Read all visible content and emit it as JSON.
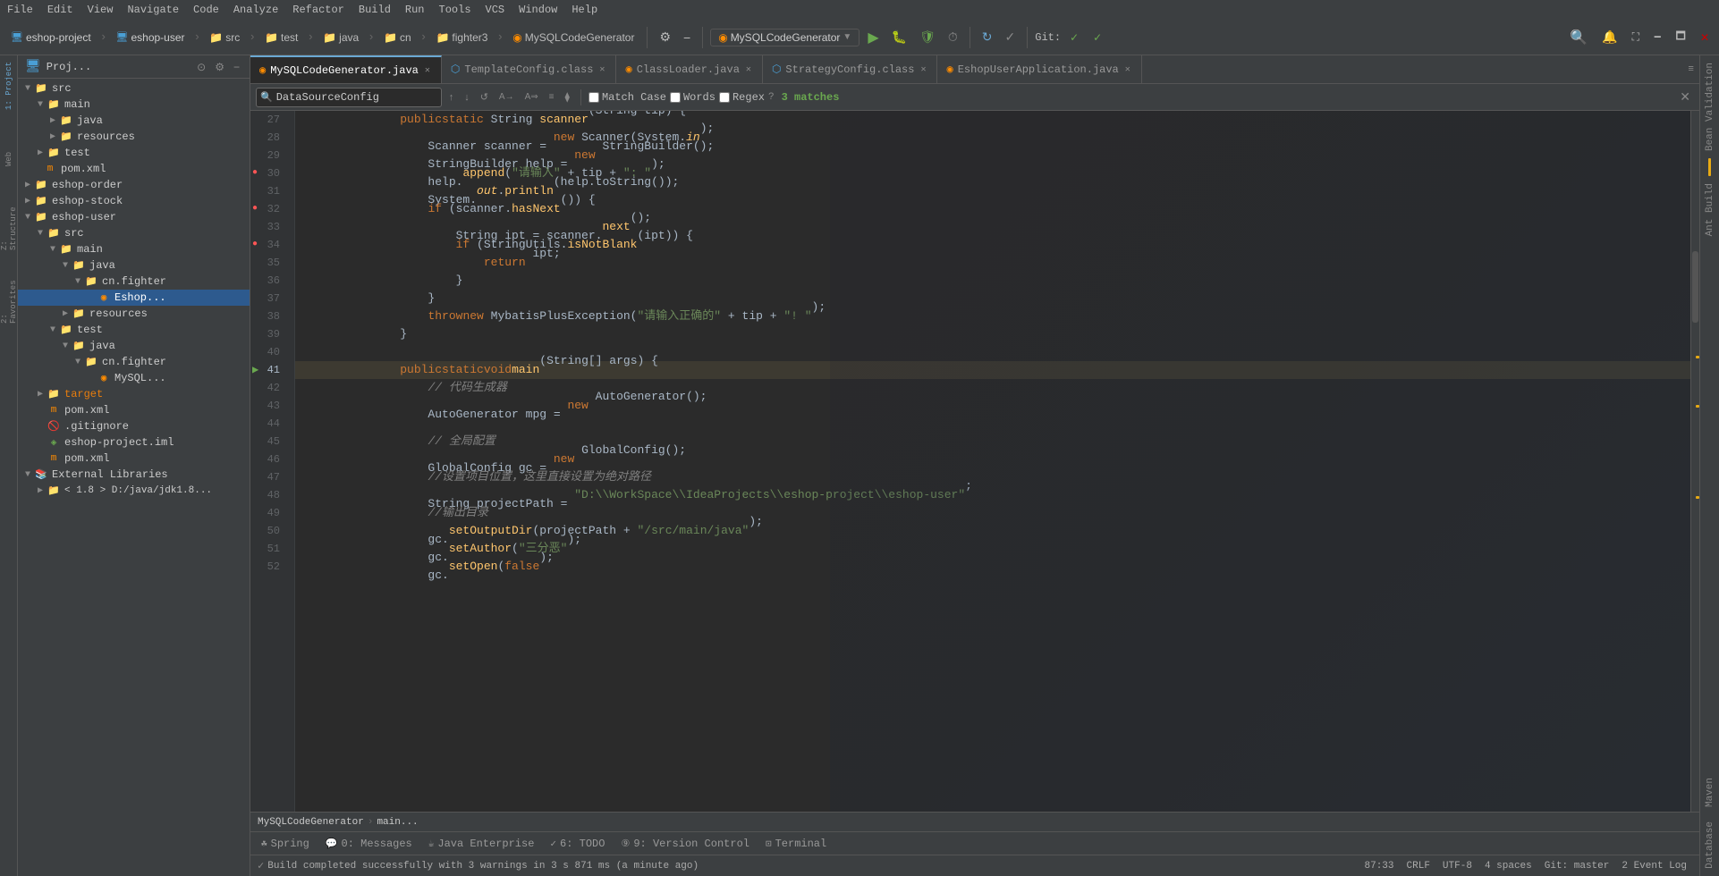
{
  "menuBar": {
    "items": [
      "File",
      "Edit",
      "View",
      "Navigate",
      "Code",
      "Analyze",
      "Refactor",
      "Build",
      "Run",
      "Tools",
      "VCS",
      "Window",
      "Help"
    ]
  },
  "toolbar": {
    "projects": [
      "eshop-project",
      "eshop-user"
    ],
    "breadcrumb": [
      "src",
      "test",
      "java",
      "cn",
      "fighter3"
    ],
    "currentFile": "MySQLCodeGenerator",
    "runDropdown": "MySQLCodeGenerator",
    "gitLabel": "Git:",
    "gitBranch": "master"
  },
  "panel": {
    "title": "Proj...",
    "tree": [
      {
        "id": 1,
        "indent": 0,
        "expanded": true,
        "type": "folder",
        "name": "src"
      },
      {
        "id": 2,
        "indent": 1,
        "expanded": true,
        "type": "folder",
        "name": "main"
      },
      {
        "id": 3,
        "indent": 2,
        "expanded": false,
        "type": "folder-blue",
        "name": "java"
      },
      {
        "id": 4,
        "indent": 2,
        "expanded": false,
        "type": "folder-resources",
        "name": "resources"
      },
      {
        "id": 5,
        "indent": 1,
        "expanded": false,
        "type": "folder",
        "name": "test"
      },
      {
        "id": 6,
        "indent": 0,
        "expanded": false,
        "type": "xml",
        "name": "pom.xml"
      },
      {
        "id": 7,
        "indent": 0,
        "expanded": true,
        "type": "folder",
        "name": "eshop-order"
      },
      {
        "id": 8,
        "indent": 0,
        "expanded": false,
        "type": "folder",
        "name": "eshop-stock"
      },
      {
        "id": 9,
        "indent": 0,
        "expanded": true,
        "type": "folder",
        "name": "eshop-user"
      },
      {
        "id": 10,
        "indent": 1,
        "expanded": true,
        "type": "folder",
        "name": "src"
      },
      {
        "id": 11,
        "indent": 2,
        "expanded": true,
        "type": "folder",
        "name": "main"
      },
      {
        "id": 12,
        "indent": 3,
        "expanded": true,
        "type": "folder-blue",
        "name": "java"
      },
      {
        "id": 13,
        "indent": 4,
        "expanded": true,
        "type": "folder",
        "name": "cn.fighter"
      },
      {
        "id": 14,
        "indent": 5,
        "expanded": false,
        "type": "java-class",
        "name": "Eshop..."
      },
      {
        "id": 15,
        "indent": 3,
        "expanded": false,
        "type": "folder-resources",
        "name": "resources"
      },
      {
        "id": 16,
        "indent": 2,
        "expanded": true,
        "type": "folder",
        "name": "test"
      },
      {
        "id": 17,
        "indent": 3,
        "expanded": true,
        "type": "folder-blue",
        "name": "java"
      },
      {
        "id": 18,
        "indent": 4,
        "expanded": true,
        "type": "folder",
        "name": "cn.fighter"
      },
      {
        "id": 19,
        "indent": 5,
        "expanded": false,
        "type": "mysql-class",
        "name": "MySQL..."
      },
      {
        "id": 20,
        "indent": 1,
        "expanded": false,
        "type": "folder-orange",
        "name": "target"
      },
      {
        "id": 21,
        "indent": 1,
        "expanded": false,
        "type": "xml",
        "name": "pom.xml"
      },
      {
        "id": 22,
        "indent": 1,
        "expanded": false,
        "type": "gitignore",
        "name": ".gitignore"
      },
      {
        "id": 23,
        "indent": 1,
        "expanded": false,
        "type": "iml",
        "name": "eshop-project.iml"
      },
      {
        "id": 24,
        "indent": 1,
        "expanded": false,
        "type": "xml",
        "name": "pom.xml"
      },
      {
        "id": 25,
        "indent": 0,
        "expanded": true,
        "type": "folder-lib",
        "name": "External Libraries"
      },
      {
        "id": 26,
        "indent": 1,
        "expanded": false,
        "type": "folder",
        "name": "< 1.8 > D:/java/jdk1.8..."
      }
    ]
  },
  "tabs": [
    {
      "id": 1,
      "label": "MySQLCodeGenerator.java",
      "active": true,
      "icon": "orange-circle",
      "closeable": true
    },
    {
      "id": 2,
      "label": "TemplateConfig.class",
      "active": false,
      "icon": "class",
      "closeable": true
    },
    {
      "id": 3,
      "label": "ClassLoader.java",
      "active": false,
      "icon": "java",
      "closeable": true
    },
    {
      "id": 4,
      "label": "StrategyConfig.class",
      "active": false,
      "icon": "class",
      "closeable": true
    },
    {
      "id": 5,
      "label": "EshopUserApplication.java",
      "active": false,
      "icon": "java",
      "closeable": true
    }
  ],
  "searchBar": {
    "placeholder": "DataSourceConfig",
    "value": "DataSourceConfig",
    "matchCase": false,
    "words": false,
    "regex": false,
    "matchCaseLabel": "Match Case",
    "wordsLabel": "Words",
    "regexLabel": "Regex",
    "matches": "3 matches"
  },
  "code": {
    "lines": [
      {
        "num": 27,
        "content": [
          {
            "t": "kw",
            "v": "public"
          },
          {
            "t": "type",
            "v": " "
          },
          {
            "t": "kw",
            "v": "static"
          },
          {
            "t": "type",
            "v": " String "
          },
          {
            "t": "method",
            "v": "scanner"
          },
          {
            "t": "type",
            "v": "(String tip) {"
          }
        ],
        "bp": false,
        "run": false
      },
      {
        "num": 28,
        "content": [
          {
            "t": "type",
            "v": "    Scanner scanner = "
          },
          {
            "t": "kw",
            "v": "new"
          },
          {
            "t": "type",
            "v": " Scanner(System."
          },
          {
            "t": "static-method",
            "v": "in"
          },
          {
            "t": "type",
            "v": ");"
          }
        ],
        "bp": false,
        "run": false
      },
      {
        "num": 29,
        "content": [
          {
            "t": "type",
            "v": "    StringBuilder help = "
          },
          {
            "t": "kw",
            "v": "new"
          },
          {
            "t": "type",
            "v": " StringBuilder();"
          }
        ],
        "bp": false,
        "run": false
      },
      {
        "num": 30,
        "content": [
          {
            "t": "type",
            "v": "    help."
          },
          {
            "t": "method",
            "v": "append"
          },
          {
            "t": "str",
            "v": "(\"请输入\""
          },
          {
            "t": "type",
            "v": " + tip + "
          },
          {
            "t": "str",
            "v": "\": \""
          }
        ],
        "bp": true,
        "run": false
      },
      {
        "num": 31,
        "content": [
          {
            "t": "type",
            "v": "    System."
          },
          {
            "t": "static-method",
            "v": "out"
          },
          {
            "t": "type",
            "v": "."
          },
          {
            "t": "method",
            "v": "println"
          },
          {
            "t": "type",
            "v": "(help.toString());"
          }
        ],
        "bp": false,
        "run": false
      },
      {
        "num": 32,
        "content": [
          {
            "t": "type",
            "v": "    "
          },
          {
            "t": "kw",
            "v": "if"
          },
          {
            "t": "type",
            "v": " (scanner."
          },
          {
            "t": "method",
            "v": "hasNext"
          },
          {
            "t": "type",
            "v": "()) {"
          }
        ],
        "bp": true,
        "run": false
      },
      {
        "num": 33,
        "content": [
          {
            "t": "type",
            "v": "        String ipt = scanner."
          },
          {
            "t": "method",
            "v": "next"
          },
          {
            "t": "type",
            "v": "();"
          }
        ],
        "bp": false,
        "run": false
      },
      {
        "num": 34,
        "content": [
          {
            "t": "type",
            "v": "        "
          },
          {
            "t": "kw",
            "v": "if"
          },
          {
            "t": "type",
            "v": " (StringUtils."
          },
          {
            "t": "method",
            "v": "isNotBlank"
          },
          {
            "t": "type",
            "v": "(ipt)) {"
          }
        ],
        "bp": true,
        "run": false
      },
      {
        "num": 35,
        "content": [
          {
            "t": "type",
            "v": "            "
          },
          {
            "t": "kw",
            "v": "return"
          },
          {
            "t": "type",
            "v": " ipt;"
          }
        ],
        "bp": false,
        "run": false
      },
      {
        "num": 36,
        "content": [
          {
            "t": "type",
            "v": "        }"
          }
        ],
        "bp": false,
        "run": false
      },
      {
        "num": 37,
        "content": [
          {
            "t": "type",
            "v": "    }"
          }
        ],
        "bp": false,
        "run": false
      },
      {
        "num": 38,
        "content": [
          {
            "t": "type",
            "v": "    "
          },
          {
            "t": "kw",
            "v": "throw"
          },
          {
            "t": "type",
            "v": " "
          },
          {
            "t": "kw",
            "v": "new"
          },
          {
            "t": "type",
            "v": " MybatisPlusException("
          },
          {
            "t": "str",
            "v": "\"请输入正确的\""
          },
          {
            "t": "type",
            "v": " + tip + "
          },
          {
            "t": "str",
            "v": "\"! \""
          }
        ],
        "bp": false,
        "run": false
      },
      {
        "num": 39,
        "content": [
          {
            "t": "type",
            "v": "}"
          }
        ],
        "bp": false,
        "run": false
      },
      {
        "num": 40,
        "content": [
          {
            "t": "type",
            "v": ""
          }
        ],
        "bp": false,
        "run": false
      },
      {
        "num": 41,
        "content": [
          {
            "t": "kw",
            "v": "public"
          },
          {
            "t": "type",
            "v": " "
          },
          {
            "t": "kw",
            "v": "static"
          },
          {
            "t": "type",
            "v": " "
          },
          {
            "t": "kw",
            "v": "void"
          },
          {
            "t": "type",
            "v": " "
          },
          {
            "t": "method",
            "v": "main"
          },
          {
            "t": "type",
            "v": "(String[] args) {"
          }
        ],
        "bp": false,
        "run": true
      },
      {
        "num": 42,
        "content": [
          {
            "t": "comment",
            "v": "    // 代码生成器"
          }
        ],
        "bp": false,
        "run": false
      },
      {
        "num": 43,
        "content": [
          {
            "t": "type",
            "v": "    AutoGenerator mpg = "
          },
          {
            "t": "kw",
            "v": "new"
          },
          {
            "t": "type",
            "v": " AutoGenerator();"
          }
        ],
        "bp": false,
        "run": false
      },
      {
        "num": 44,
        "content": [
          {
            "t": "type",
            "v": ""
          }
        ],
        "bp": false,
        "run": false
      },
      {
        "num": 45,
        "content": [
          {
            "t": "comment",
            "v": "    // 全局配置"
          }
        ],
        "bp": false,
        "run": false
      },
      {
        "num": 46,
        "content": [
          {
            "t": "type",
            "v": "    GlobalConfig gc = "
          },
          {
            "t": "kw",
            "v": "new"
          },
          {
            "t": "type",
            "v": " GlobalConfig();"
          }
        ],
        "bp": false,
        "run": false
      },
      {
        "num": 47,
        "content": [
          {
            "t": "cn-comment",
            "v": "    //设置项目位置，这里直接设置为绝对路径"
          }
        ],
        "bp": false,
        "run": false
      },
      {
        "num": 48,
        "content": [
          {
            "t": "type",
            "v": "    String projectPath = "
          },
          {
            "t": "str",
            "v": "\"D:\\\\WorkSpace\\\\IdeaProjects\\\\eshop-project\\\\eshop-user\""
          }
        ],
        "bp": false,
        "run": false
      },
      {
        "num": 49,
        "content": [
          {
            "t": "cn-comment",
            "v": "    //输出目录"
          }
        ],
        "bp": false,
        "run": false
      },
      {
        "num": 50,
        "content": [
          {
            "t": "type",
            "v": "    gc."
          },
          {
            "t": "method",
            "v": "setOutputDir"
          },
          {
            "t": "type",
            "v": "(projectPath + "
          },
          {
            "t": "str",
            "v": "\"/src/main/java\""
          },
          {
            "t": "type",
            "v": ");"
          }
        ],
        "bp": false,
        "run": false
      },
      {
        "num": 51,
        "content": [
          {
            "t": "type",
            "v": "    gc."
          },
          {
            "t": "method",
            "v": "setAuthor"
          },
          {
            "t": "type",
            "v": "("
          },
          {
            "t": "str",
            "v": "\"三分恶\""
          },
          {
            "t": "type",
            "v": ");"
          }
        ],
        "bp": false,
        "run": false
      },
      {
        "num": 52,
        "content": [
          {
            "t": "type",
            "v": "    gc."
          },
          {
            "t": "method",
            "v": "setOpen"
          },
          {
            "t": "type",
            "v": "("
          },
          {
            "t": "kw",
            "v": "false"
          },
          {
            "t": "type",
            "v": ");"
          }
        ],
        "bp": false,
        "run": false
      }
    ]
  },
  "breadcrumb": {
    "path": [
      "MySQLCodeGenerator",
      "main..."
    ]
  },
  "bottomTabs": [
    {
      "label": "Spring",
      "icon": "☘"
    },
    {
      "label": "0: Messages",
      "icon": "💬"
    },
    {
      "label": "Java Enterprise",
      "icon": "☕"
    },
    {
      "label": "6: TODO",
      "icon": "✓"
    },
    {
      "label": "9: Version Control",
      "icon": "⑨"
    },
    {
      "label": "Terminal",
      "icon": "⊡"
    }
  ],
  "statusBar": {
    "message": "Build completed successfully with 3 warnings in 3 s 871 ms (a minute ago)",
    "position": "87:33",
    "lineEnding": "CRLF",
    "encoding": "UTF-8",
    "indent": "4 spaces",
    "git": "Git: master",
    "eventLog": "2 Event Log"
  },
  "rightSidebar": {
    "labels": [
      "Bean Validation",
      "Ant Build",
      "Maven",
      "Database"
    ]
  }
}
